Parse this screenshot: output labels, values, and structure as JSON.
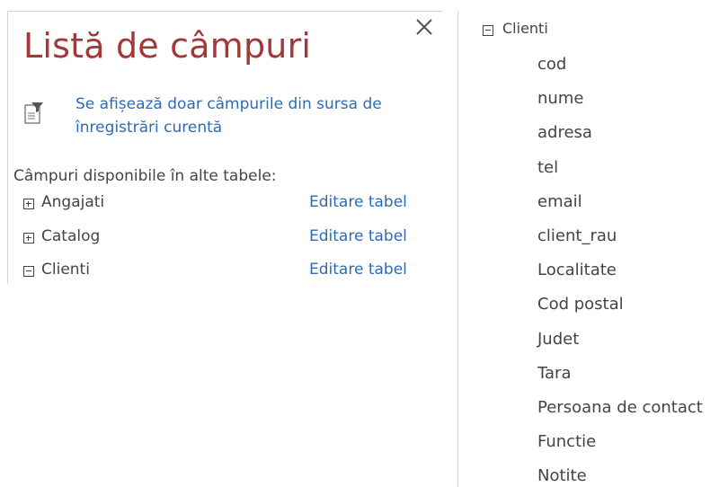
{
  "panel": {
    "title": "Listă de câmpuri",
    "close_label": "×",
    "info_text": "Se afișează doar câmpurile din sursa de înregistrări curentă",
    "info_icon": "filter-document-icon",
    "section_label": "Câmpuri disponibile în alte tabele:",
    "tables": [
      {
        "name": "Angajati",
        "edit_label": "Editare tabel",
        "expanded": false
      },
      {
        "name": "Catalog",
        "edit_label": "Editare tabel",
        "expanded": false
      },
      {
        "name": "Clienti",
        "edit_label": "Editare tabel",
        "expanded": true
      }
    ]
  },
  "expanded_table": {
    "name": "Clienti",
    "fields": [
      "cod",
      "nume",
      "adresa",
      "tel",
      "email",
      "client_rau",
      "Localitate",
      "Cod postal",
      "Judet",
      "Tara",
      "Persoana de contact",
      "Functie",
      "Notite"
    ]
  },
  "colors": {
    "title": "#a4373a",
    "link": "#2e6bb4",
    "text": "#444444",
    "border": "#d4d4d4"
  }
}
